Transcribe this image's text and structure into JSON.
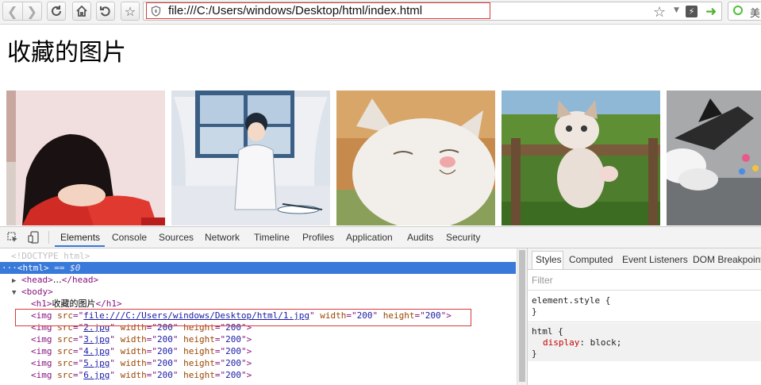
{
  "browser": {
    "address_url": "file:///C:/Users/windows/Desktop/html/index.html",
    "search_engine_label": "美"
  },
  "page": {
    "title": "收藏的图片",
    "images": [
      {
        "name": "anime-girl-sleeping-thumbnail",
        "src": "1.jpg"
      },
      {
        "name": "illustration-boy-thumbnail",
        "src": "2.jpg"
      },
      {
        "name": "white-cat-thumbnail",
        "src": "3.jpg"
      },
      {
        "name": "kitten-on-fence-thumbnail",
        "src": "4.jpg"
      },
      {
        "name": "bird-plane-thumbnail",
        "src": "5.jpg"
      }
    ]
  },
  "devtools": {
    "tabs": [
      "Elements",
      "Console",
      "Sources",
      "Network",
      "Timeline",
      "Profiles",
      "Application",
      "Audits",
      "Security"
    ],
    "active_tab": "Elements",
    "dom": {
      "doctype": "<!DOCTYPE html>",
      "html_tag": "<html>",
      "html_eq": "== $0",
      "head_open": "<head>",
      "head_ellipsis": "…",
      "head_close": "</head>",
      "body_open": "<body>",
      "h1_open": "<h1>",
      "h1_text": "收藏的图片",
      "h1_close": "</h1>",
      "img_rows": [
        {
          "src": "file:///C:/Users/windows/Desktop/html/1.jpg",
          "width": "200",
          "height": "200"
        },
        {
          "src": "2.jpg",
          "width": "200",
          "height": "200"
        },
        {
          "src": "3.jpg",
          "width": "200",
          "height": "200"
        },
        {
          "src": "4.jpg",
          "width": "200",
          "height": "200"
        },
        {
          "src": "5.jpg",
          "width": "200",
          "height": "200"
        },
        {
          "src": "6.jpg",
          "width": "200",
          "height": "200"
        }
      ]
    },
    "styles": {
      "tabs": [
        "Styles",
        "Computed",
        "Event Listeners",
        "DOM Breakpoints"
      ],
      "filter_placeholder": "Filter",
      "element_style_selector": "element.style {",
      "close_brace": "}",
      "html_selector": "html {",
      "html_prop_name": "display",
      "html_prop_value": "block;"
    }
  },
  "colors": {
    "selection_blue": "#3879d9",
    "highlight_red": "#d93a3a",
    "tag_purple": "#881280",
    "attr_brown": "#994500",
    "value_blue": "#1a1aa6"
  }
}
